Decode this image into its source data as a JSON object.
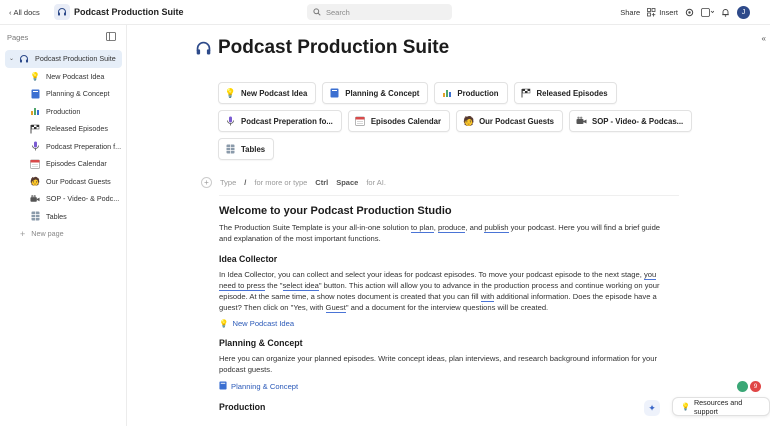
{
  "topbar": {
    "back_label": "All docs",
    "doc_title": "Podcast Production Suite",
    "search_placeholder": "Search",
    "share_label": "Share",
    "insert_label": "Insert",
    "avatar_initial": "J"
  },
  "sidebar": {
    "header": "Pages",
    "root": {
      "label": "Podcast Production Suite",
      "icon": "headphones-icon"
    },
    "items": [
      {
        "label": "New Podcast Idea",
        "icon": "lightbulb-icon"
      },
      {
        "label": "Planning & Concept",
        "icon": "notebook-icon"
      },
      {
        "label": "Production",
        "icon": "bar-chart-icon"
      },
      {
        "label": "Released Episodes",
        "icon": "checkered-flag-icon"
      },
      {
        "label": "Podcast Preperation f...",
        "icon": "microphone-icon"
      },
      {
        "label": "Episodes Calendar",
        "icon": "calendar-icon"
      },
      {
        "label": "Our Podcast Guests",
        "icon": "guest-icon"
      },
      {
        "label": "SOP - Video- & Podc...",
        "icon": "video-camera-icon"
      },
      {
        "label": "Tables",
        "icon": "table-icon"
      }
    ],
    "new_page_label": "New page"
  },
  "main": {
    "title": "Podcast Production Suite",
    "chips_row1": [
      {
        "label": "New Podcast Idea",
        "icon": "lightbulb-icon"
      },
      {
        "label": "Planning & Concept",
        "icon": "notebook-icon"
      },
      {
        "label": "Production",
        "icon": "bar-chart-icon"
      },
      {
        "label": "Released Episodes",
        "icon": "checkered-flag-icon"
      }
    ],
    "chips_row2": [
      {
        "label": "Podcast Preperation fo...",
        "icon": "microphone-icon"
      },
      {
        "label": "Episodes Calendar",
        "icon": "calendar-icon"
      },
      {
        "label": "Our Podcast Guests",
        "icon": "guest-icon"
      },
      {
        "label": "SOP - Video- & Podcas...",
        "icon": "video-camera-icon"
      }
    ],
    "chips_row3": [
      {
        "label": "Tables",
        "icon": "table-icon"
      }
    ],
    "placeholder": {
      "type": "Type",
      "slash": "/",
      "more": "for more or type",
      "ctrl": "Ctrl",
      "space": "Space",
      "ai": "for AI."
    },
    "welcome_heading": "Welcome to your Podcast Production Studio",
    "intro_a": "The Production Suite Template is your all-in-one solution ",
    "intro_link1": "to plan",
    "intro_b": ", ",
    "intro_link2": "produce",
    "intro_c": ", and ",
    "intro_link3": "publish",
    "intro_d": " your podcast. Here you will find a brief guide and explanation of the most important functions.",
    "idea_heading": "Idea Collector",
    "idea_a": "In Idea Collector, you can collect and select your ideas for podcast episodes. To move your podcast episode to the next stage, ",
    "idea_link1": "you need to press",
    "idea_b": " the \"",
    "idea_link2": "select idea",
    "idea_c": "\" button. This action will allow you to advance in the production process and continue working on your episode. At the same time, a show notes document is created that you can fill ",
    "idea_link3": "with",
    "idea_d": " additional information. Does the episode have a guest? Then click on \"Yes, with ",
    "idea_link4": "Guest",
    "idea_e": "\" and a document for the interview questions will be created.",
    "idea_link_label": "New Podcast Idea",
    "planning_heading": "Planning & Concept",
    "planning_text": "Here you can organize your planned episodes. Write concept ideas, plan interviews, and research background information for your podcast guests.",
    "planning_link_label": "Planning & Concept",
    "production_heading": "Production",
    "resources_label": "Resources and support",
    "ext_badge": "9"
  }
}
